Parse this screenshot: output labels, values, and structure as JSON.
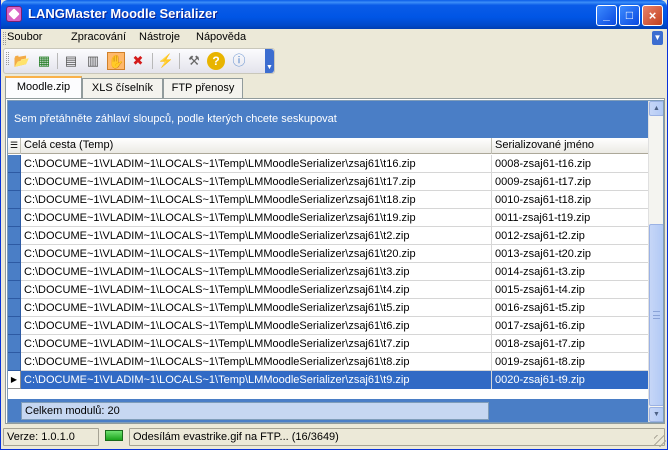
{
  "window": {
    "title": "LANGMaster Moodle Serializer",
    "controls": {
      "minimize": "_",
      "maximize": "□",
      "close": "×"
    }
  },
  "menu": {
    "items": [
      "Soubor",
      "Zpracování",
      "Nástroje",
      "Nápověda"
    ]
  },
  "toolbar": {
    "buttons": [
      {
        "icon": "open-folder-icon",
        "glyph": "📂"
      },
      {
        "icon": "excel-export-icon",
        "glyph": "▦"
      },
      {
        "icon": "document-icon",
        "glyph": "▤"
      },
      {
        "icon": "documents-icon",
        "glyph": "▥"
      },
      {
        "icon": "hand-stop-icon",
        "glyph": "✋",
        "active": true
      },
      {
        "icon": "delete-icon",
        "glyph": "✖"
      },
      {
        "icon": "lightning-icon",
        "glyph": "⚡"
      },
      {
        "icon": "tools-icon",
        "glyph": "⚒"
      },
      {
        "icon": "help-icon",
        "glyph": "?"
      },
      {
        "icon": "info-icon",
        "glyph": "ⓘ"
      }
    ]
  },
  "tabs": [
    {
      "label": "Moodle.zip",
      "active": true
    },
    {
      "label": "XLS číselník",
      "active": false
    },
    {
      "label": "FTP přenosy",
      "active": false
    }
  ],
  "grid": {
    "group_hint": "Sem přetáhněte záhlaví sloupců, podle kterých chcete seskupovat",
    "columns": [
      "Celá cesta (Temp)",
      "Serializované jméno"
    ],
    "rows": [
      {
        "path": "C:\\DOCUME~1\\VLADIM~1\\LOCALS~1\\Temp\\LMMoodleSerializer\\zsaj61\\t16.zip",
        "name": "0008-zsaj61-t16.zip"
      },
      {
        "path": "C:\\DOCUME~1\\VLADIM~1\\LOCALS~1\\Temp\\LMMoodleSerializer\\zsaj61\\t17.zip",
        "name": "0009-zsaj61-t17.zip"
      },
      {
        "path": "C:\\DOCUME~1\\VLADIM~1\\LOCALS~1\\Temp\\LMMoodleSerializer\\zsaj61\\t18.zip",
        "name": "0010-zsaj61-t18.zip"
      },
      {
        "path": "C:\\DOCUME~1\\VLADIM~1\\LOCALS~1\\Temp\\LMMoodleSerializer\\zsaj61\\t19.zip",
        "name": "0011-zsaj61-t19.zip"
      },
      {
        "path": "C:\\DOCUME~1\\VLADIM~1\\LOCALS~1\\Temp\\LMMoodleSerializer\\zsaj61\\t2.zip",
        "name": "0012-zsaj61-t2.zip"
      },
      {
        "path": "C:\\DOCUME~1\\VLADIM~1\\LOCALS~1\\Temp\\LMMoodleSerializer\\zsaj61\\t20.zip",
        "name": "0013-zsaj61-t20.zip"
      },
      {
        "path": "C:\\DOCUME~1\\VLADIM~1\\LOCALS~1\\Temp\\LMMoodleSerializer\\zsaj61\\t3.zip",
        "name": "0014-zsaj61-t3.zip"
      },
      {
        "path": "C:\\DOCUME~1\\VLADIM~1\\LOCALS~1\\Temp\\LMMoodleSerializer\\zsaj61\\t4.zip",
        "name": "0015-zsaj61-t4.zip"
      },
      {
        "path": "C:\\DOCUME~1\\VLADIM~1\\LOCALS~1\\Temp\\LMMoodleSerializer\\zsaj61\\t5.zip",
        "name": "0016-zsaj61-t5.zip"
      },
      {
        "path": "C:\\DOCUME~1\\VLADIM~1\\LOCALS~1\\Temp\\LMMoodleSerializer\\zsaj61\\t6.zip",
        "name": "0017-zsaj61-t6.zip"
      },
      {
        "path": "C:\\DOCUME~1\\VLADIM~1\\LOCALS~1\\Temp\\LMMoodleSerializer\\zsaj61\\t7.zip",
        "name": "0018-zsaj61-t7.zip"
      },
      {
        "path": "C:\\DOCUME~1\\VLADIM~1\\LOCALS~1\\Temp\\LMMoodleSerializer\\zsaj61\\t8.zip",
        "name": "0019-zsaj61-t8.zip"
      },
      {
        "path": "C:\\DOCUME~1\\VLADIM~1\\LOCALS~1\\Temp\\LMMoodleSerializer\\zsaj61\\t9.zip",
        "name": "0020-zsaj61-t9.zip",
        "selected": true
      }
    ],
    "footer": "Celkem modulů: 20"
  },
  "status": {
    "version": "Verze: 1.0.1.0",
    "message": "Odesílám evastrike.gif na FTP... (16/3649)"
  },
  "colors": {
    "accent": "#316ac5",
    "group_panel": "#4a7ec6",
    "title_bar": "#0055e5",
    "tab_highlight": "#f9b14a",
    "status_led": "#1aa31c"
  }
}
